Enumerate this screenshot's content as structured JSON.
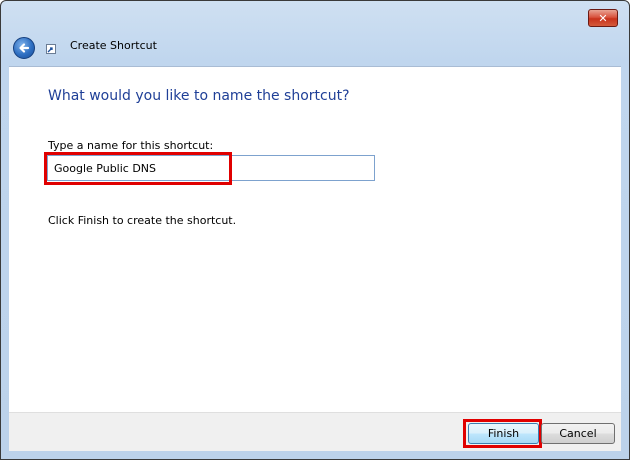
{
  "window": {
    "title": "Create Shortcut",
    "close_label": "✕"
  },
  "content": {
    "heading": "What would you like to name the shortcut?",
    "name_label": "Type a name for this shortcut:",
    "name_value": "Google Public DNS",
    "hint": "Click Finish to create the shortcut."
  },
  "footer": {
    "finish_label": "Finish",
    "cancel_label": "Cancel"
  },
  "colors": {
    "heading": "#1f3f97",
    "highlight": "#e00000",
    "close_button": "#c8321c"
  },
  "icons": [
    "close-icon",
    "back-arrow-icon",
    "shortcut-icon"
  ]
}
